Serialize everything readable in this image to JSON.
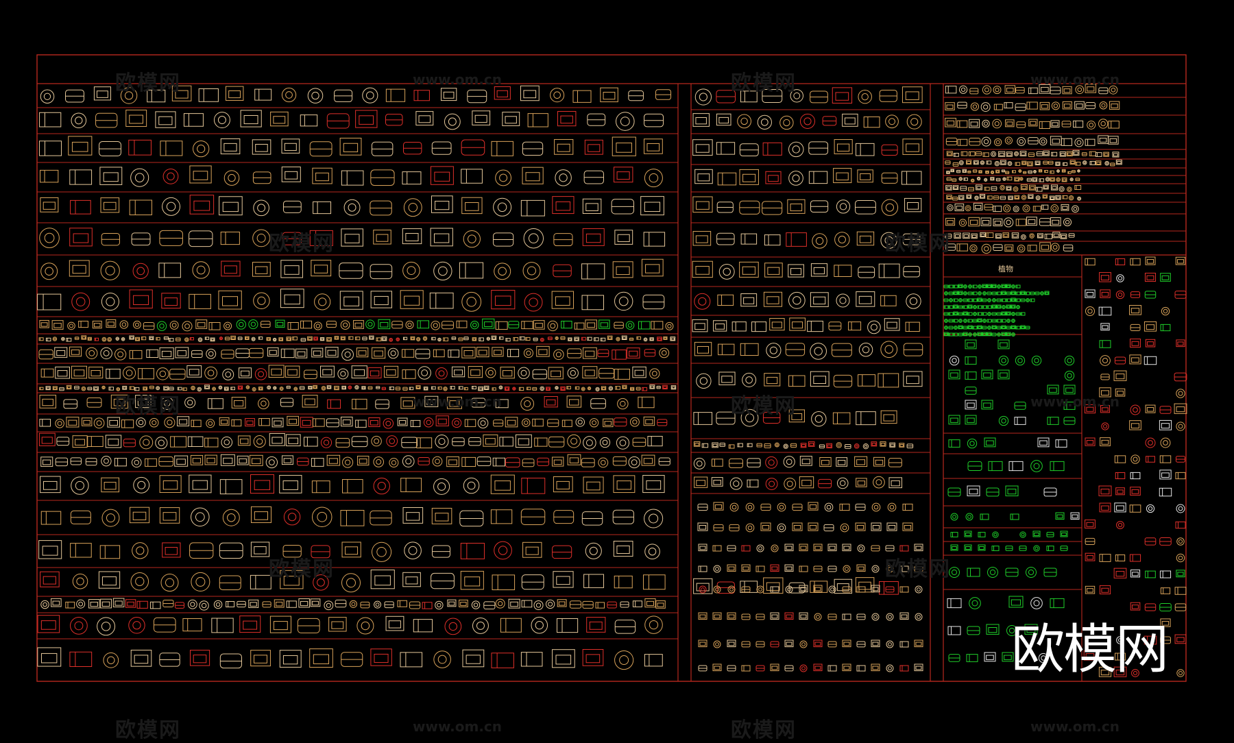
{
  "watermark": {
    "text": "欧模网",
    "url": "www.om.cn"
  },
  "brand_logo": "欧模网",
  "plant_section_label": "植物",
  "colors": {
    "background": "#000000",
    "frame": "#b8281e",
    "block_tan": "#d9a35a",
    "block_cream": "#e6c89a",
    "block_red": "#e0302a",
    "block_green": "#1fd02a",
    "block_white": "#e8e8e8"
  },
  "layout_summary": {
    "left_panel_rows": 20,
    "middle_panel_rows": 16,
    "right_top_rows": 14,
    "right_bottom_label_column": "植物"
  }
}
